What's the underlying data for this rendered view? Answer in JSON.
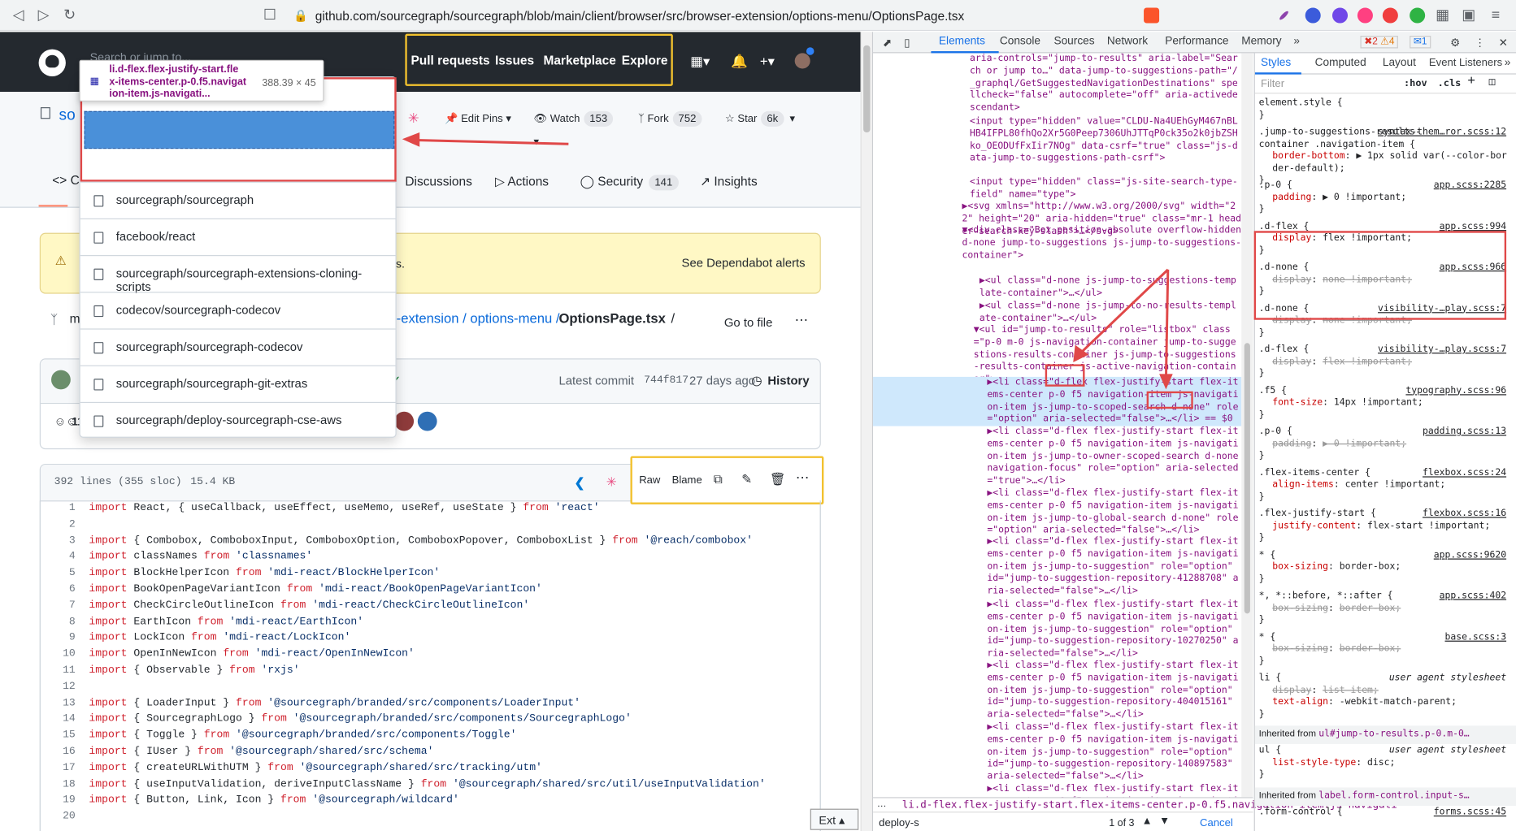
{
  "browser": {
    "url": "github.com/sourcegraph/sourcegraph/blob/main/client/browser/src/browser-extension/options-menu/OptionsPage.tsx",
    "badge": "1"
  },
  "github": {
    "search_placeholder": "Search or jump to...",
    "nav": [
      "Pull requests",
      "Issues",
      "Marketplace",
      "Explore"
    ],
    "repo_owner_short": "so",
    "edit_pins": "Edit Pins",
    "watch": {
      "label": "Watch",
      "count": "153"
    },
    "fork": {
      "label": "Fork",
      "count": "752"
    },
    "star": {
      "label": "Star",
      "count": "6k"
    },
    "tabs": [
      {
        "label": "Discussions"
      },
      {
        "label": "Actions"
      },
      {
        "label": "Security",
        "count": "141"
      },
      {
        "label": "Insights"
      }
    ],
    "code_tab_short": "C",
    "alert_text": "ues.",
    "alert_button": "See Dependabot alerts",
    "breadcrumb": {
      "prefix": "m",
      "path": "-extension / options-menu /",
      "file": "OptionsPage.tsx",
      "sep": "/",
      "goto": "Go to file"
    },
    "commit": {
      "latest": "Latest commit",
      "hash": "744f817",
      "age": "27 days ago",
      "history": "History",
      "contributors_short": "11"
    },
    "file": {
      "lines": "392 lines (355 sloc)",
      "size": "15.4 KB",
      "raw": "Raw",
      "blame": "Blame"
    },
    "dropdown": {
      "tooltip_title": "li.d-flex.flex-justify-start.fle",
      "tooltip_sub1": "x-items-center.p-0.f5.navigat",
      "tooltip_sub2": "ion-item.js-navigati...",
      "tooltip_size": "388.39 × 45",
      "items": [
        "sourcegraph/sourcegraph",
        "facebook/react",
        "sourcegraph/sourcegraph-extensions-cloning-scripts",
        "codecov/sourcegraph-codecov",
        "sourcegraph/sourcegraph-codecov",
        "sourcegraph/sourcegraph-git-extras",
        "sourcegraph/deploy-sourcegraph-cse-aws"
      ]
    },
    "ext_label": "Ext",
    "code_lines": [
      {
        "n": "1",
        "t": "import React, { useCallback, useEffect, useMemo, useRef, useState } from 'react'"
      },
      {
        "n": "2",
        "t": ""
      },
      {
        "n": "3",
        "t": "import { Combobox, ComboboxInput, ComboboxOption, ComboboxPopover, ComboboxList } from '@reach/combobox'"
      },
      {
        "n": "4",
        "t": "import classNames from 'classnames'"
      },
      {
        "n": "5",
        "t": "import BlockHelperIcon from 'mdi-react/BlockHelperIcon'"
      },
      {
        "n": "6",
        "t": "import BookOpenPageVariantIcon from 'mdi-react/BookOpenPageVariantIcon'"
      },
      {
        "n": "7",
        "t": "import CheckCircleOutlineIcon from 'mdi-react/CheckCircleOutlineIcon'"
      },
      {
        "n": "8",
        "t": "import EarthIcon from 'mdi-react/EarthIcon'"
      },
      {
        "n": "9",
        "t": "import LockIcon from 'mdi-react/LockIcon'"
      },
      {
        "n": "10",
        "t": "import OpenInNewIcon from 'mdi-react/OpenInNewIcon'"
      },
      {
        "n": "11",
        "t": "import { Observable } from 'rxjs'"
      },
      {
        "n": "12",
        "t": ""
      },
      {
        "n": "13",
        "t": "import { LoaderInput } from '@sourcegraph/branded/src/components/LoaderInput'"
      },
      {
        "n": "14",
        "t": "import { SourcegraphLogo } from '@sourcegraph/branded/src/components/SourcegraphLogo'"
      },
      {
        "n": "15",
        "t": "import { Toggle } from '@sourcegraph/branded/src/components/Toggle'"
      },
      {
        "n": "16",
        "t": "import { IUser } from '@sourcegraph/shared/src/schema'"
      },
      {
        "n": "17",
        "t": "import { createURLWithUTM } from '@sourcegraph/shared/src/tracking/utm'"
      },
      {
        "n": "18",
        "t": "import { useInputValidation, deriveInputClassName } from '@sourcegraph/shared/src/util/useInputValidation'"
      },
      {
        "n": "19",
        "t": "import { Button, Link, Icon } from '@sourcegraph/wildcard'"
      },
      {
        "n": "20",
        "t": ""
      }
    ]
  },
  "devtools": {
    "tabs": [
      "Elements",
      "Console",
      "Sources",
      "Network",
      "Performance",
      "Memory"
    ],
    "errors": "2",
    "warnings": "4",
    "messages": "1",
    "styles_tabs": [
      "Styles",
      "Computed",
      "Layout",
      "Event Listeners"
    ],
    "filter_placeholder": "Filter",
    "hov": ":hov",
    "cls": ".cls",
    "elements_lines": [
      "aria-controls=\"jump-to-results\" aria-label=\"Search or jump to…\" data-jump-to-suggestions-path=\"/_graphql/GetSuggestedNavigationDestinations\" spellcheck=\"false\" autocomplete=\"off\" aria-activedescendant>",
      "<input type=\"hidden\" value=\"CLDU-Na4UEhGyM467nBLHB4IFPL80fhQo2Xr5G0Peep7306UhJTTqP0ck35o2k0jbZSHko_OEODUfFxIir7NOg\" data-csrf=\"true\" class=\"js-data-jump-to-suggestions-path-csrf\">",
      "<input type=\"hidden\" class=\"js-site-search-type-field\" name=\"type\">",
      "▶<svg xmlns=\"http://www.w3.org/2000/svg\" width=\"22\" height=\"20\" aria-hidden=\"true\" class=\"mr-1 header-search-key-slash\">…</svg>",
      "▼<div class=\"Box position-absolute overflow-hidden d-none jump-to-suggestions js-jump-to-suggestions-container\">",
      "▶<ul class=\"d-none js-jump-to-suggestions-template-container\">…</ul>",
      "▶<ul class=\"d-none js-jump-to-no-results-template-container\">…</ul>",
      "▼<ul id=\"jump-to-results\" role=\"listbox\" class=\"p-0 m-0 js-navigation-container jump-to-suggestions-results-container js-jump-to-suggestions-results-container js-active-navigation-container\">",
      "▶<li class=\"d-flex flex-justify-start flex-items-center p-0 f5 navigation-item js-navigation-item js-jump-to-scoped-search d-none\" role=\"option\" aria-selected=\"false\">…</li> == $0",
      "▶<li class=\"d-flex flex-justify-start flex-items-center p-0 f5 navigation-item js-navigation-item js-jump-to-owner-scoped-search d-none navigation-focus\" role=\"option\" aria-selected=\"true\">…</li>",
      "▶<li class=\"d-flex flex-justify-start flex-items-center p-0 f5 navigation-item js-navigation-item js-jump-to-global-search d-none\" role=\"option\" aria-selected=\"false\">…</li>",
      "▶<li class=\"d-flex flex-justify-start flex-items-center p-0 f5 navigation-item js-navigation-item js-jump-to-suggestion\" role=\"option\" id=\"jump-to-suggestion-repository-41288708\" aria-selected=\"false\">…</li>",
      "▶<li class=\"d-flex flex-justify-start flex-items-center p-0 f5 navigation-item js-navigation-item js-jump-to-suggestion\" role=\"option\" id=\"jump-to-suggestion-repository-10270250\" aria-selected=\"false\">…</li>",
      "▶<li class=\"d-flex flex-justify-start flex-items-center p-0 f5 navigation-item js-navigation-item js-jump-to-suggestion\" role=\"option\" id=\"jump-to-suggestion-repository-404015161\" aria-selected=\"false\">…</li>",
      "▶<li class=\"d-flex flex-justify-start flex-items-center p-0 f5 navigation-item js-navigation-item js-jump-to-suggestion\" role=\"option\" id=\"jump-to-suggestion-repository-140897583\" aria-selected=\"false\">…</li>",
      "▶<li class=\"d-flex flex-justify-start flex-items-center p-0 f5 navigation-item js-navigation-item"
    ],
    "breadcrumb": "li.d-flex.flex-justify-start.flex-items-center.p-0.f5.navigation-item.js-navigati",
    "search_value": "deploy-s",
    "search_count": "1 of 3",
    "cancel": "Cancel",
    "flex_badge": "flex",
    "dflex_label": "d-flex",
    "dnone_label": "d-none",
    "styles": [
      {
        "sel": "element.style {",
        "src": "",
        "body": [],
        "end": "}"
      },
      {
        "sel": ".jump-to-suggestions-results-container .navigation-item {",
        "src": "syntax-them…ror.scss:12",
        "body": [
          [
            "border-bottom",
            "▶ 1px solid var(--color-border-default);",
            false
          ]
        ],
        "end": "}"
      },
      {
        "sel": ".p-0 {",
        "src": "app.scss:2285",
        "body": [
          [
            "padding",
            "▶ 0 !important;",
            false
          ]
        ],
        "end": "}"
      },
      {
        "sel": ".d-flex {",
        "src": "app.scss:994",
        "body": [
          [
            "display",
            "flex !important;",
            false
          ]
        ],
        "end": "}"
      },
      {
        "sel": ".d-none {",
        "src": "app.scss:966",
        "body": [
          [
            "display",
            "none !important;",
            true
          ]
        ],
        "end": "}"
      },
      {
        "sel": ".d-none {",
        "src": "visibility-…play.scss:7",
        "body": [
          [
            "display",
            "none !important;",
            true
          ]
        ],
        "end": "}"
      },
      {
        "sel": ".d-flex {",
        "src": "visibility-…play.scss:7",
        "body": [
          [
            "display",
            "flex !important;",
            true
          ]
        ],
        "end": "}"
      },
      {
        "sel": ".f5 {",
        "src": "typography.scss:96",
        "body": [
          [
            "font-size",
            "14px !important;",
            false
          ]
        ],
        "end": "}"
      },
      {
        "sel": ".p-0 {",
        "src": "padding.scss:13",
        "body": [
          [
            "padding",
            "▶ 0 !important;",
            true
          ]
        ],
        "end": "}"
      },
      {
        "sel": ".flex-items-center {",
        "src": "flexbox.scss:24",
        "body": [
          [
            "align-items",
            "center !important;",
            false
          ]
        ],
        "end": "}"
      },
      {
        "sel": ".flex-justify-start {",
        "src": "flexbox.scss:16",
        "body": [
          [
            "justify-content",
            "flex-start !important;",
            false
          ]
        ],
        "end": "}"
      },
      {
        "sel": "* {",
        "src": "app.scss:9620",
        "body": [
          [
            "box-sizing",
            "border-box;",
            false
          ]
        ],
        "end": "}"
      },
      {
        "sel": "*, *::before, *::after {",
        "src": "app.scss:402",
        "body": [
          [
            "box-sizing",
            "border-box;",
            true
          ]
        ],
        "end": "}"
      },
      {
        "sel": "* {",
        "src": "base.scss:3",
        "body": [
          [
            "box-sizing",
            "border-box;",
            true
          ]
        ],
        "end": "}"
      },
      {
        "sel": "li {",
        "src": "user agent stylesheet",
        "body": [
          [
            "display",
            "list-item;",
            true
          ],
          [
            "text-align",
            "-webkit-match-parent;",
            false
          ]
        ],
        "end": "}"
      }
    ],
    "inherited1": "Inherited from",
    "inherited1_sel": "ul#jump-to-results.p-0.m-0…",
    "ul_rule": {
      "sel": "ul {",
      "src": "user agent stylesheet",
      "prop": "list-style-type",
      "val": "disc;"
    },
    "inherited2": "Inherited from",
    "inherited2_sel": "label.form-control.input-s…",
    "form_control": {
      "sel": ".form-control {",
      "src": "forms.scss:45"
    }
  }
}
